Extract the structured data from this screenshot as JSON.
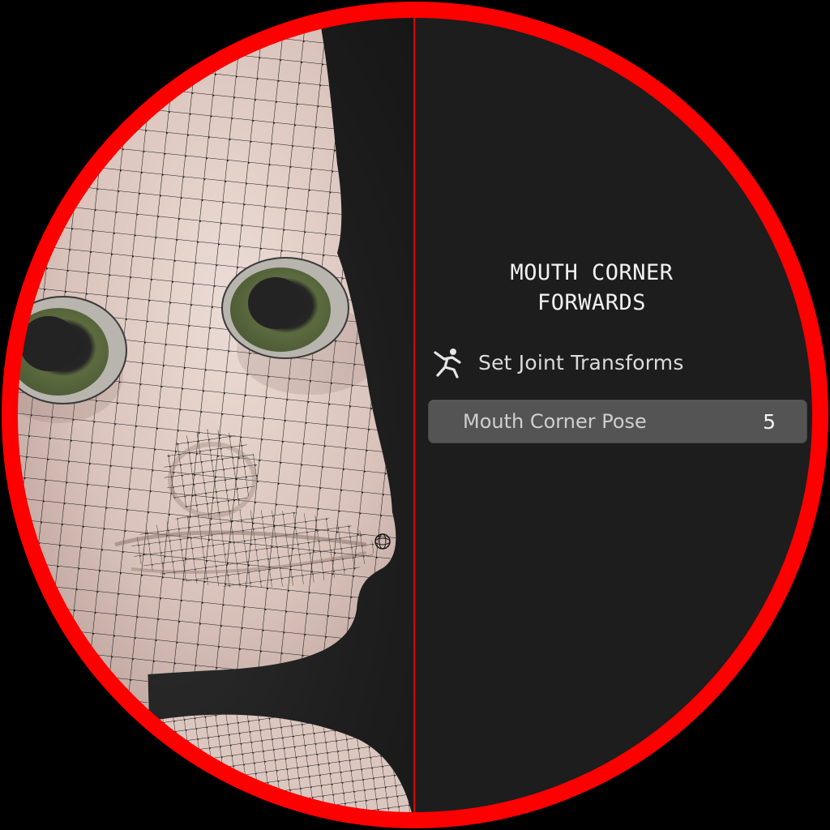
{
  "panel": {
    "title_line1": "MOUTH CORNER",
    "title_line2": "FORWARDS",
    "operator": {
      "label": "Set Joint Transforms",
      "icon": "armature-pose-icon"
    },
    "property": {
      "label": "Mouth Corner Pose",
      "value": "5"
    }
  },
  "colors": {
    "ring": "#ff0000",
    "divider": "#e00000",
    "panel_bg": "#1d1d1d",
    "field_bg": "#545454",
    "skin": "#e3cfc8"
  }
}
